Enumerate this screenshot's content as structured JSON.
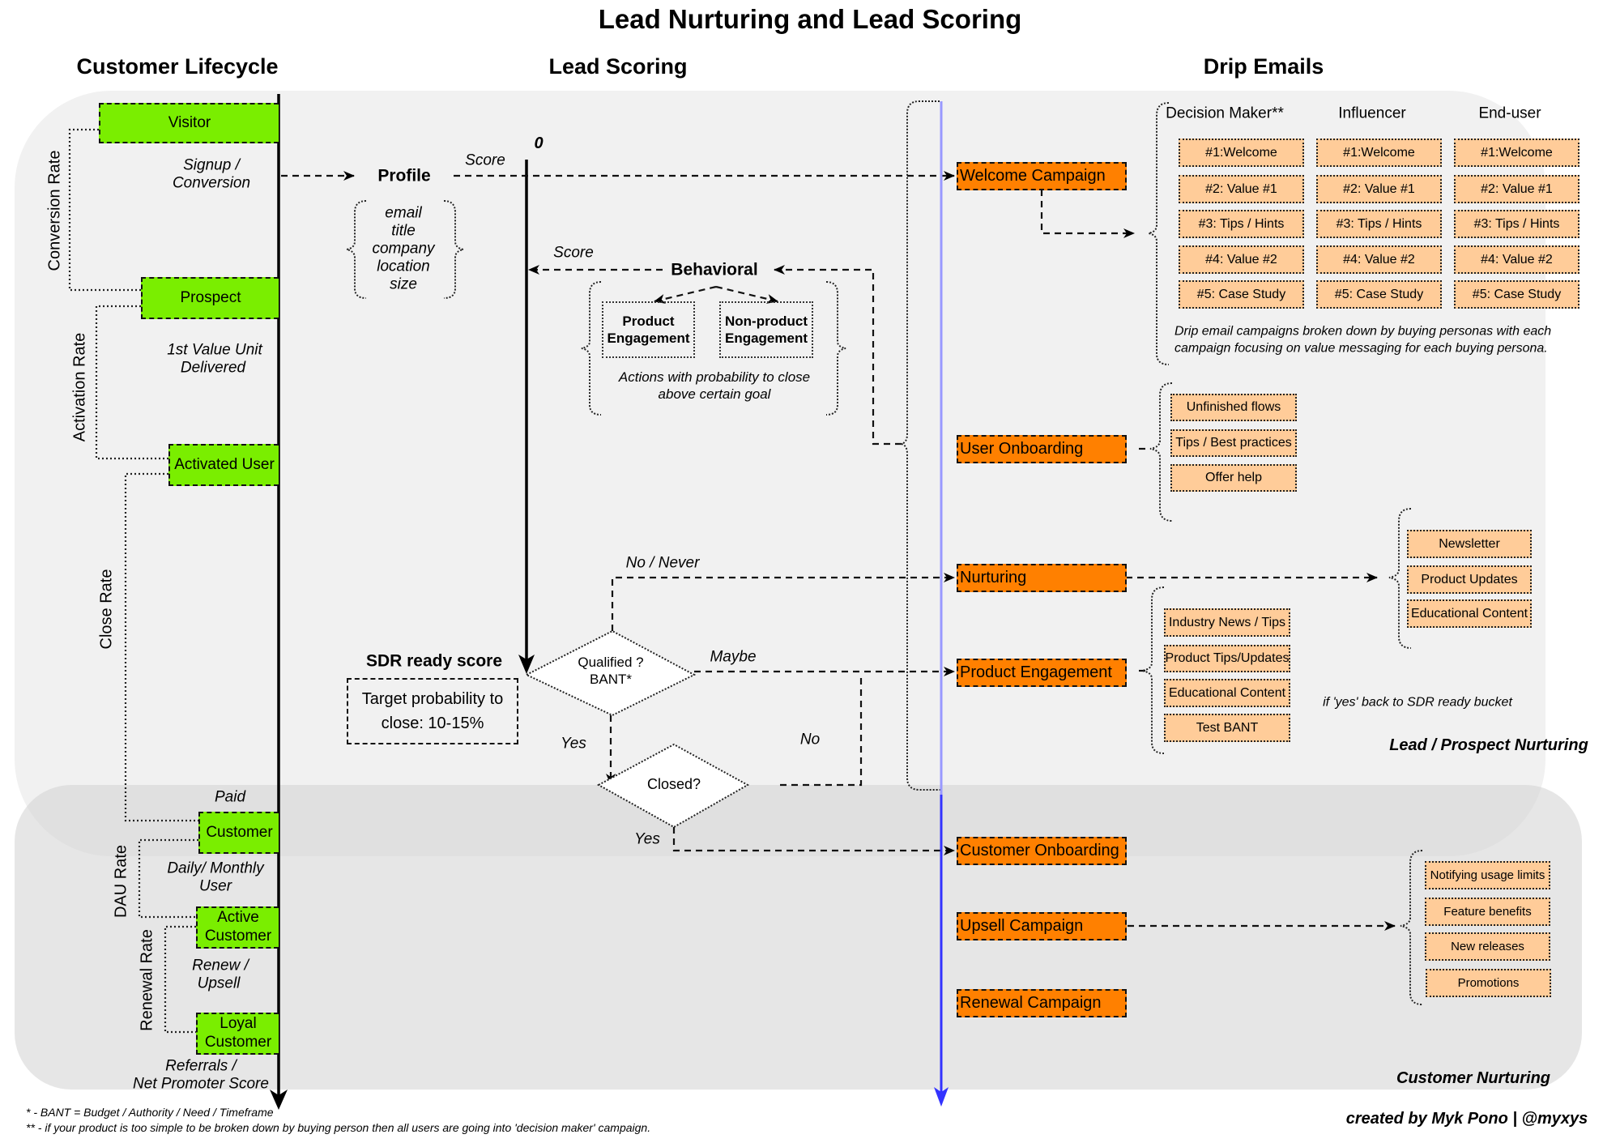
{
  "title": "Lead Nurturing and Lead Scoring",
  "columns": {
    "lifecycle": "Customer Lifecycle",
    "scoring": "Lead Scoring",
    "drip": "Drip Emails"
  },
  "lifecycle": {
    "stages": {
      "visitor": "Visitor",
      "prospect": "Prospect",
      "activated": "Activated User",
      "customer": "Customer",
      "active_l1": "Active",
      "active_l2": "Customer",
      "loyal_l1": "Loyal",
      "loyal_l2": "Customer"
    },
    "transitions": {
      "signup_l1": "Signup /",
      "signup_l2": "Conversion",
      "value_l1": "1st Value Unit",
      "value_l2": "Delivered",
      "paid": "Paid",
      "dau_l1": "Daily/ Monthly",
      "dau_l2": "User",
      "renew_l1": "Renew /",
      "renew_l2": "Upsell",
      "referrals_l1": "Referrals /",
      "referrals_l2": "Net Promoter Score"
    },
    "rates": {
      "conversion": "Conversion Rate",
      "activation": "Activation Rate",
      "close": "Close Rate",
      "dau": "DAU Rate",
      "renewal": "Renewal Rate"
    }
  },
  "scoring": {
    "zero": "0",
    "score_label": "Score",
    "profile": "Profile",
    "profile_attrs": [
      "email",
      "title",
      "company",
      "location",
      "size"
    ],
    "behavioral": "Behavioral",
    "product_engagement_l1": "Product",
    "product_engagement_l2": "Engagement",
    "nonproduct_engagement_l1": "Non-product",
    "nonproduct_engagement_l2": "Engagement",
    "behavior_note_l1": "Actions with probability to close",
    "behavior_note_l2": "above certain goal",
    "sdr_title": "SDR ready score",
    "sdr_l1": "Target probability to",
    "sdr_l2": "close: 10-15%",
    "qualified_l1": "Qualified ?",
    "qualified_l2": "BANT*",
    "closed": "Closed?",
    "edge_no_never": "No / Never",
    "edge_maybe": "Maybe",
    "edge_yes": "Yes",
    "edge_no": "No",
    "edge_yes2": "Yes"
  },
  "campaigns": {
    "welcome": "Welcome Campaign",
    "user_onboarding": "User Onboarding",
    "nurturing": "Nurturing",
    "product_engagement": "Product Engagement",
    "customer_onboarding": "Customer Onboarding",
    "upsell": "Upsell Campaign",
    "renewal": "Renewal Campaign"
  },
  "personas": {
    "headers": [
      "Decision Maker**",
      "Influencer",
      "End-user"
    ],
    "emails": [
      "#1:Welcome",
      "#2: Value #1",
      "#3: Tips / Hints",
      "#4: Value #2",
      "#5: Case Study"
    ],
    "note_l1": "Drip email campaigns broken down by buying personas with each",
    "note_l2": "campaign focusing on value messaging for each buying persona."
  },
  "onboarding_emails": [
    "Unfinished flows",
    "Tips / Best practices",
    "Offer help"
  ],
  "nurturing_emails": [
    "Newsletter",
    "Product Updates",
    "Educational Content"
  ],
  "engagement_emails": [
    "Industry News / Tips",
    "Product Tips/Updates",
    "Educational Content",
    "Test BANT"
  ],
  "engagement_note": "if 'yes' back to SDR ready bucket",
  "upsell_emails": [
    "Notifying usage limits",
    "Feature benefits",
    "New releases",
    "Promotions"
  ],
  "sections": {
    "lead": "Lead / Prospect Nurturing",
    "customer": "Customer Nurturing"
  },
  "footnotes": {
    "bant": "* - BANT = Budget / Authority / Need / Timeframe",
    "dm": "** - if your product is too simple to be broken down by buying person then all users are going into 'decision maker' campaign."
  },
  "credit": "created by Myk Pono | @myxys",
  "colors": {
    "stage_green": "#7aee00",
    "campaign_orange": "#ff8000",
    "email_peach": "#ffcc99",
    "timeline_blue": "#3333ff",
    "panel_light": "#f1f1f1"
  }
}
